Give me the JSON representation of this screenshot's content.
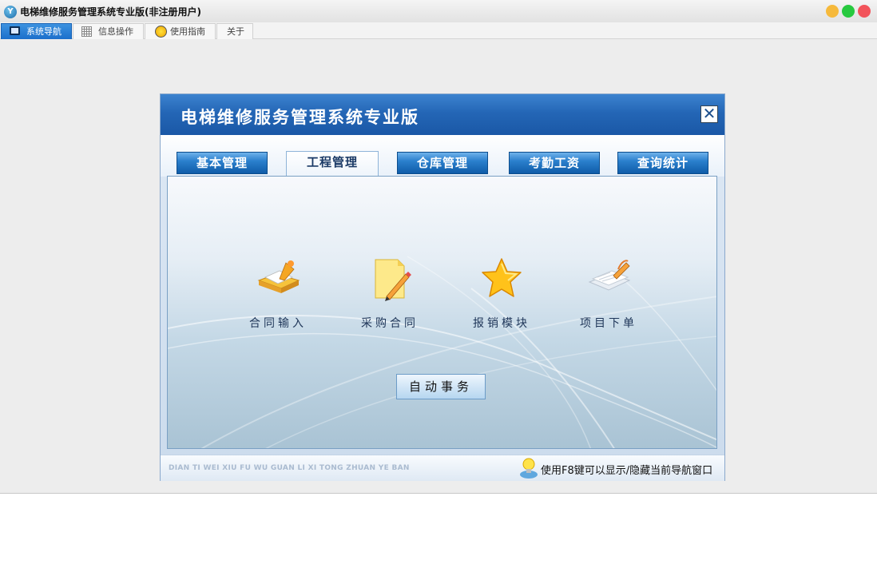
{
  "window": {
    "logo_text": "Y",
    "title": "电梯维修服务管理系统专业版(非注册用户)"
  },
  "main_tabs": [
    {
      "label": "系统导航",
      "icon": "monitor-icon",
      "active": true
    },
    {
      "label": "信息操作",
      "icon": "grid-icon",
      "active": false
    },
    {
      "label": "使用指南",
      "icon": "lightbulb-icon",
      "active": false
    },
    {
      "label": "关于",
      "icon": "",
      "active": false
    }
  ],
  "dialog": {
    "title": "电梯维修服务管理系统专业版",
    "close_glyph": "✕",
    "tabs": [
      "基本管理",
      "工程管理",
      "仓库管理",
      "考勤工资",
      "查询统计"
    ],
    "active_tab": "工程管理",
    "modules": [
      {
        "label": "合同输入",
        "icon": "contract-folder-icon"
      },
      {
        "label": "采购合同",
        "icon": "document-pencil-icon"
      },
      {
        "label": "报销模块",
        "icon": "star-icon"
      },
      {
        "label": "项目下单",
        "icon": "papers-pencil-icon"
      }
    ],
    "auto_button": "自动事务",
    "footer_pinyin": "DIAN TI WEI XIU FU WU GUAN LI XI TONG ZHUAN YE BAN",
    "footer_hint": "使用F8键可以显示/隐藏当前导航窗口"
  },
  "colors": {
    "header_blue": "#2466b6",
    "tab_blue": "#1b6fcb",
    "traffic_yellow": "#f6b93b",
    "traffic_green": "#27c93f",
    "traffic_red": "#f2545b"
  }
}
